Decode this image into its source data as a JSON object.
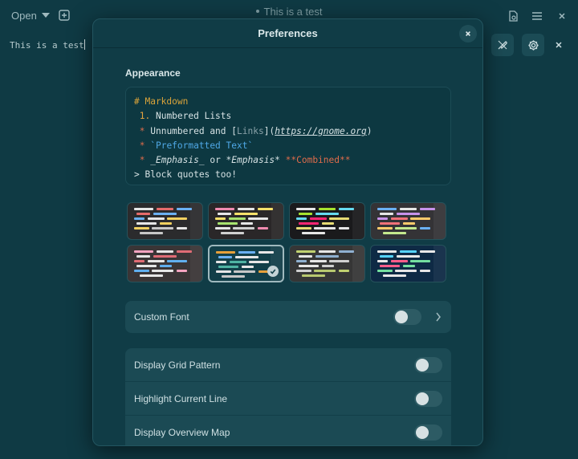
{
  "window": {
    "title": "This is a test",
    "open_label": "Open",
    "editor_text": "This is a test"
  },
  "dialog": {
    "title": "Preferences",
    "section_appearance": "Appearance",
    "preview_lines": {
      "l1": "# Markdown",
      "l2_num": "1.",
      "l2_text": " Numbered Lists",
      "l3_star": "*",
      "l3_text": " Unnumbered and [",
      "l3_link": "Links",
      "l3_close": "](",
      "l3_url": "https://gnome.org",
      "l3_end": ")",
      "l4_star": "*",
      "l4_code": " `Preformatted Text`",
      "l5_star": "*",
      "l5_em1": " _Emphasis_",
      "l5_or": " or ",
      "l5_em2": "*Emphasis*",
      "l5_bold": " **Combined**",
      "l6": "> Block quotes too!"
    },
    "schemes": [
      {
        "name": "scheme-1",
        "bg": "#2b2b2d",
        "selected": false
      },
      {
        "name": "scheme-2",
        "bg": "#2a2728",
        "selected": false
      },
      {
        "name": "scheme-3",
        "bg": "#1a1a1c",
        "selected": false
      },
      {
        "name": "scheme-4",
        "bg": "#343336",
        "selected": false
      },
      {
        "name": "scheme-5",
        "bg": "#3a3536",
        "selected": false
      },
      {
        "name": "scheme-6",
        "bg": "#123f49",
        "selected": true
      },
      {
        "name": "scheme-7",
        "bg": "#363636",
        "selected": false
      },
      {
        "name": "scheme-8",
        "bg": "#0e2a45",
        "selected": false
      }
    ],
    "rows": {
      "custom_font": "Custom Font",
      "grid_pattern": "Display Grid Pattern",
      "highlight_line": "Highlight Current Line",
      "overview_map": "Display Overview Map"
    }
  },
  "colors": {
    "accent": "#1b4a54",
    "background": "#0f3a44"
  }
}
